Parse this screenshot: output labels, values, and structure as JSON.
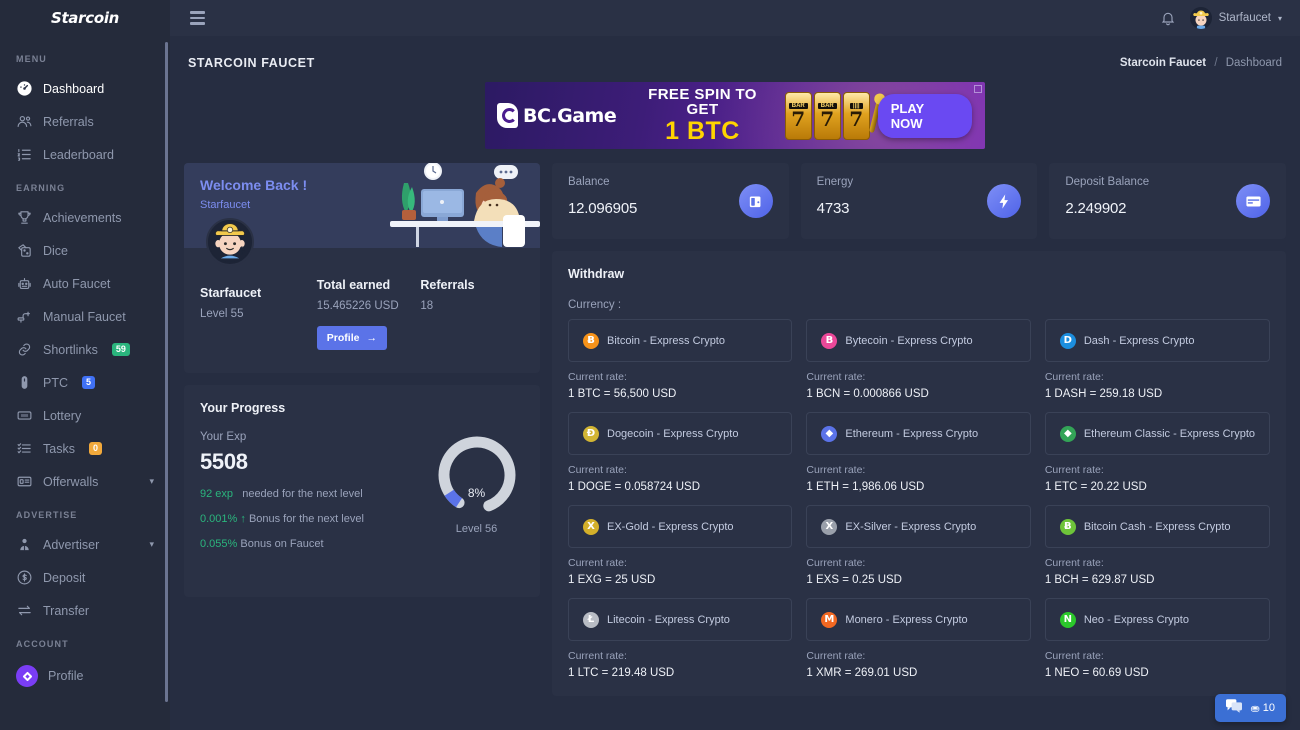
{
  "brand": {
    "name": "Starcoin"
  },
  "sidebar": {
    "sections": [
      {
        "label": "MENU",
        "items": [
          {
            "label": "Dashboard",
            "icon": "speedometer-icon",
            "active": true
          },
          {
            "label": "Referrals",
            "icon": "users-icon"
          },
          {
            "label": "Leaderboard",
            "icon": "list-ordered-icon"
          }
        ]
      },
      {
        "label": "EARNING",
        "items": [
          {
            "label": "Achievements",
            "icon": "trophy-icon"
          },
          {
            "label": "Dice",
            "icon": "dice-icon"
          },
          {
            "label": "Auto Faucet",
            "icon": "robot-icon"
          },
          {
            "label": "Manual Faucet",
            "icon": "faucet-icon"
          },
          {
            "label": "Shortlinks",
            "icon": "link-icon",
            "badge": "59",
            "badge_color": "green"
          },
          {
            "label": "PTC",
            "icon": "mouse-icon",
            "badge": "5",
            "badge_color": "blue"
          },
          {
            "label": "Lottery",
            "icon": "ticket-icon"
          },
          {
            "label": "Tasks",
            "icon": "tasklist-icon",
            "badge": "0",
            "badge_color": "amber"
          },
          {
            "label": "Offerwalls",
            "icon": "offerwall-icon",
            "chevron": true
          }
        ]
      },
      {
        "label": "ADVERTISE",
        "items": [
          {
            "label": "Advertiser",
            "icon": "advertiser-icon",
            "chevron": true
          },
          {
            "label": "Deposit",
            "icon": "coin-deposit-icon"
          },
          {
            "label": "Transfer",
            "icon": "transfer-icon"
          }
        ]
      },
      {
        "label": "ACCOUNT",
        "items": [
          {
            "label": "Profile",
            "icon": "profile-dot-icon"
          }
        ]
      }
    ]
  },
  "topbar": {
    "notification_icon": "bell-icon",
    "user_name": "Starfaucet",
    "caret": "⌄"
  },
  "page": {
    "title": "STARCOIN FAUCET",
    "breadcrumb_root": "Starcoin Faucet",
    "breadcrumb_sep": "/",
    "breadcrumb_current": "Dashboard"
  },
  "banner": {
    "brand": "BC.Game",
    "line1": "FREE SPIN TO GET",
    "line2": "1 BTC",
    "cta": "PLAY NOW",
    "reel_bar": "BAR",
    "reel_seven": "7"
  },
  "welcome": {
    "greeting": "Welcome Back !",
    "username_sub": "Starfaucet",
    "name": "Starfaucet",
    "level": "Level 55",
    "total_earned_label": "Total earned",
    "total_earned_value": "15.465226 USD",
    "referrals_label": "Referrals",
    "referrals_value": "18",
    "profile_button": "Profile",
    "profile_arrow": "→"
  },
  "progress": {
    "title": "Your Progress",
    "exp_label": "Your Exp",
    "exp_value": "5508",
    "needed_amount": "92 exp",
    "needed_text": "needed for the next level",
    "bonus_next_amount": "0.001%",
    "bonus_next_arrow": "↑",
    "bonus_next_text": "Bonus for the next level",
    "bonus_faucet_amount": "0.055%",
    "bonus_faucet_text": "Bonus on Faucet",
    "ring_percent": "8%",
    "ring_level": "Level 56",
    "ring_value": 8
  },
  "stats": [
    {
      "label": "Balance",
      "value": "12.096905",
      "icon": "wallet-icon"
    },
    {
      "label": "Energy",
      "value": "4733",
      "icon": "bolt-icon"
    },
    {
      "label": "Deposit Balance",
      "value": "2.249902",
      "icon": "card-icon"
    }
  ],
  "withdraw": {
    "title": "Withdraw",
    "currency_label": "Currency :",
    "rate_label": "Current rate:",
    "currencies": [
      {
        "name": "Bitcoin - Express Crypto",
        "symbol": "Ƀ",
        "color": "#f7931a",
        "rate": "1 BTC = 56,500 USD"
      },
      {
        "name": "Bytecoin - Express Crypto",
        "symbol": "B",
        "color": "#ec4899",
        "rate": "1 BCN = 0.000866 USD"
      },
      {
        "name": "Dash - Express Crypto",
        "symbol": "D",
        "color": "#1c8ede",
        "rate": "1 DASH = 259.18 USD"
      },
      {
        "name": "Dogecoin - Express Crypto",
        "symbol": "Ð",
        "color": "#d2b534",
        "rate": "1 DOGE = 0.058724 USD"
      },
      {
        "name": "Ethereum - Express Crypto",
        "symbol": "◆",
        "color": "#5b73e8",
        "rate": "1 ETH = 1,986.06 USD"
      },
      {
        "name": "Ethereum Classic - Express Crypto",
        "symbol": "◆",
        "color": "#33a457",
        "rate": "1 ETC = 20.22 USD"
      },
      {
        "name": "EX-Gold - Express Crypto",
        "symbol": "X",
        "color": "#d4b02a",
        "rate": "1 EXG = 25 USD"
      },
      {
        "name": "EX-Silver - Express Crypto",
        "symbol": "X",
        "color": "#9aa0ab",
        "rate": "1 EXS = 0.25 USD"
      },
      {
        "name": "Bitcoin Cash - Express Crypto",
        "symbol": "Ƀ",
        "color": "#6ec43a",
        "rate": "1 BCH = 629.87 USD"
      },
      {
        "name": "Litecoin - Express Crypto",
        "symbol": "Ł",
        "color": "#b8bcc4",
        "rate": "1 LTC = 219.48 USD"
      },
      {
        "name": "Monero - Express Crypto",
        "symbol": "M",
        "color": "#f26822",
        "rate": "1 XMR = 269.01 USD"
      },
      {
        "name": "Neo - Express Crypto",
        "symbol": "N",
        "color": "#2bc82b",
        "rate": "1 NEO = 60.69 USD"
      }
    ]
  },
  "chat": {
    "icon": "chat-icon",
    "user_icon": "⛂",
    "online_count": "10"
  }
}
